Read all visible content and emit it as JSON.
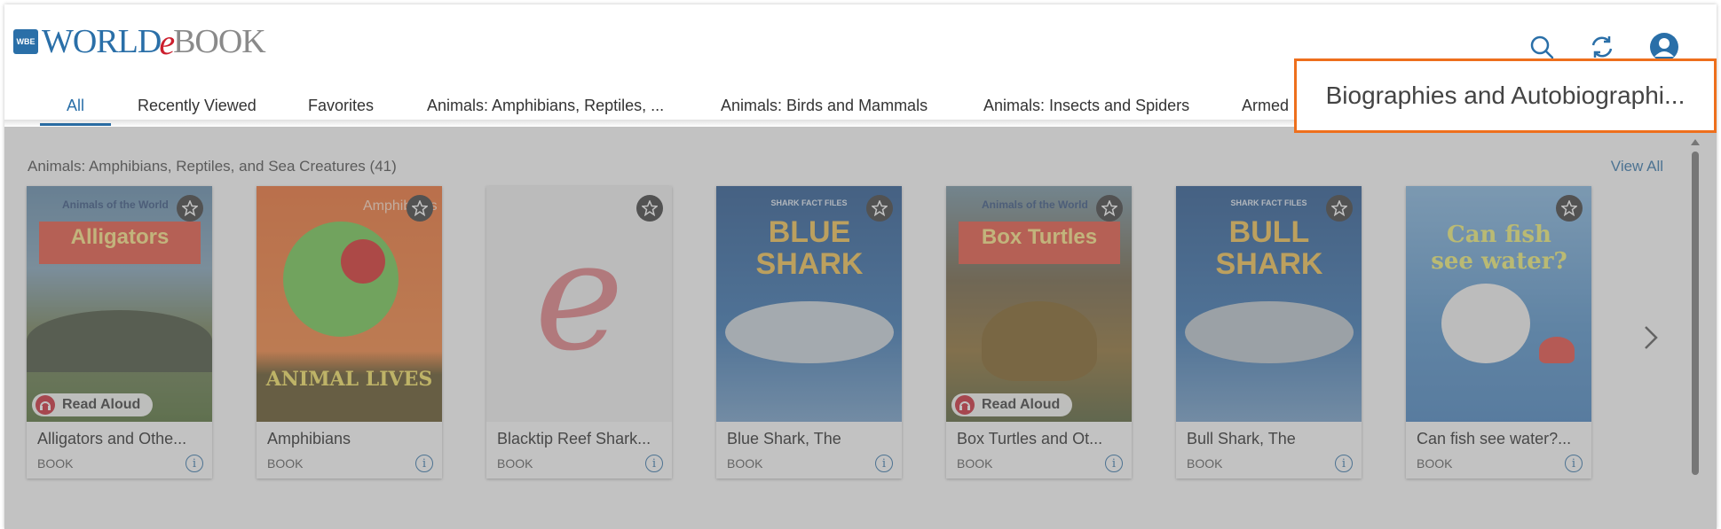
{
  "header": {
    "logo": {
      "world": "WORLD",
      "e": "e",
      "book": "BOOK",
      "badge": "WBE"
    },
    "icons": [
      "search-icon",
      "refresh-icon",
      "user-avatar-icon"
    ]
  },
  "tabs": [
    {
      "label": "All",
      "active": true
    },
    {
      "label": "Recently Viewed"
    },
    {
      "label": "Favorites"
    },
    {
      "label": "Animals: Amphibians, Reptiles, ..."
    },
    {
      "label": "Animals: Birds and Mammals"
    },
    {
      "label": "Animals: Insects and Spiders"
    },
    {
      "label": "Armed"
    }
  ],
  "highlighted_tab": {
    "label": "Biographies and Autobiographi..."
  },
  "section": {
    "title": "Animals: Amphibians, Reptiles, and Sea Creatures (41)",
    "view_all": "View All"
  },
  "cards": [
    {
      "title": "Alligators and Othe...",
      "type": "BOOK",
      "read_aloud": "Read Aloud",
      "cover_text": "Alligators",
      "series": "Animals of the World"
    },
    {
      "title": "Amphibians",
      "type": "BOOK",
      "cover_text": "ANIMAL LIVES",
      "series": "Amphibians"
    },
    {
      "title": "Blacktip Reef Shark...",
      "type": "BOOK",
      "cover_text": "e"
    },
    {
      "title": "Blue Shark, The",
      "type": "BOOK",
      "cover_text": "BLUE SHARK",
      "series": "SHARK FACT FILES"
    },
    {
      "title": "Box Turtles and Ot...",
      "type": "BOOK",
      "read_aloud": "Read Aloud",
      "cover_text": "Box Turtles",
      "series": "Animals of the World"
    },
    {
      "title": "Bull Shark, The",
      "type": "BOOK",
      "cover_text": "BULL SHARK",
      "series": "SHARK FACT FILES"
    },
    {
      "title": "Can fish see water?...",
      "type": "BOOK",
      "cover_text": "Can fish see water?"
    }
  ],
  "colors": {
    "accent": "#2a6fa8",
    "brand_red": "#cc1f2e",
    "highlight": "#ee6f1c"
  }
}
